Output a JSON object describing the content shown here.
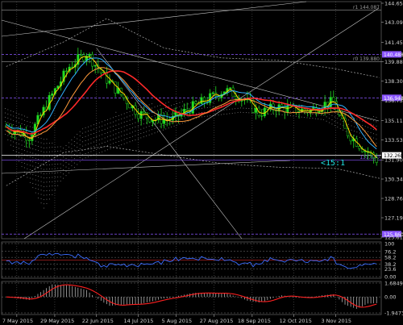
{
  "chart_data": {
    "type": "line",
    "instrument_note": "",
    "price_axis_ticks": [
      "144.650",
      "143.095",
      "141.455",
      "139.880",
      "138.305",
      "136.730",
      "135.110",
      "133.535",
      "131.900",
      "130.340",
      "128.765",
      "127.190",
      "125.615"
    ],
    "price_ylim": [
      125.615,
      144.65
    ],
    "rsi_axis_ticks": [
      "100",
      "76.2",
      "58.2",
      "38.2",
      "23.6",
      "0.00"
    ],
    "macd_axis_ticks": [
      "1.6849",
      "0.00",
      "-1.9473"
    ],
    "date_labels": [
      "7 May 2015",
      "29 May 2015",
      "22 Jun 2015",
      "14 Jul 2015",
      "5 Aug 2015",
      "27 Aug 2015",
      "18 Sep 2015",
      "12 Oct 2015",
      "3 Nov 2015"
    ],
    "levels": [
      {
        "label": "r1 144.087",
        "value": 144.087,
        "color": "#9a9a9a",
        "boxed": false
      },
      {
        "label": "140.488",
        "value": 140.488,
        "color": "#8a55ff",
        "boxed": true
      },
      {
        "label": "r0 139.880",
        "value": 139.88,
        "color": "#9a9a9a",
        "boxed": false
      },
      {
        "label": "136.948",
        "value": 136.948,
        "color": "#8a55ff",
        "boxed": true
      },
      {
        "label": "132.268",
        "value": 132.268,
        "color": "#ffffff",
        "boxed": true,
        "dark_text": true
      },
      {
        "label": "131.880",
        "value": 131.88,
        "color": "#8a55ff",
        "boxed": false
      },
      {
        "label": "125.860",
        "value": 125.86,
        "color": "#8a55ff",
        "boxed": true
      }
    ],
    "annotation": "<15:1",
    "annotation_color": "#20e0e0",
    "colors": {
      "candles": "#22dd22",
      "price_lines": [
        "#ffd400",
        "#30b0ff",
        "#ff2a2a",
        "#ff9a3a"
      ],
      "rsi_line": "#3a6cff",
      "macd_line": "#ff2020",
      "grid": "#6a6a6a",
      "trendlines": "#c8c8c8"
    }
  }
}
